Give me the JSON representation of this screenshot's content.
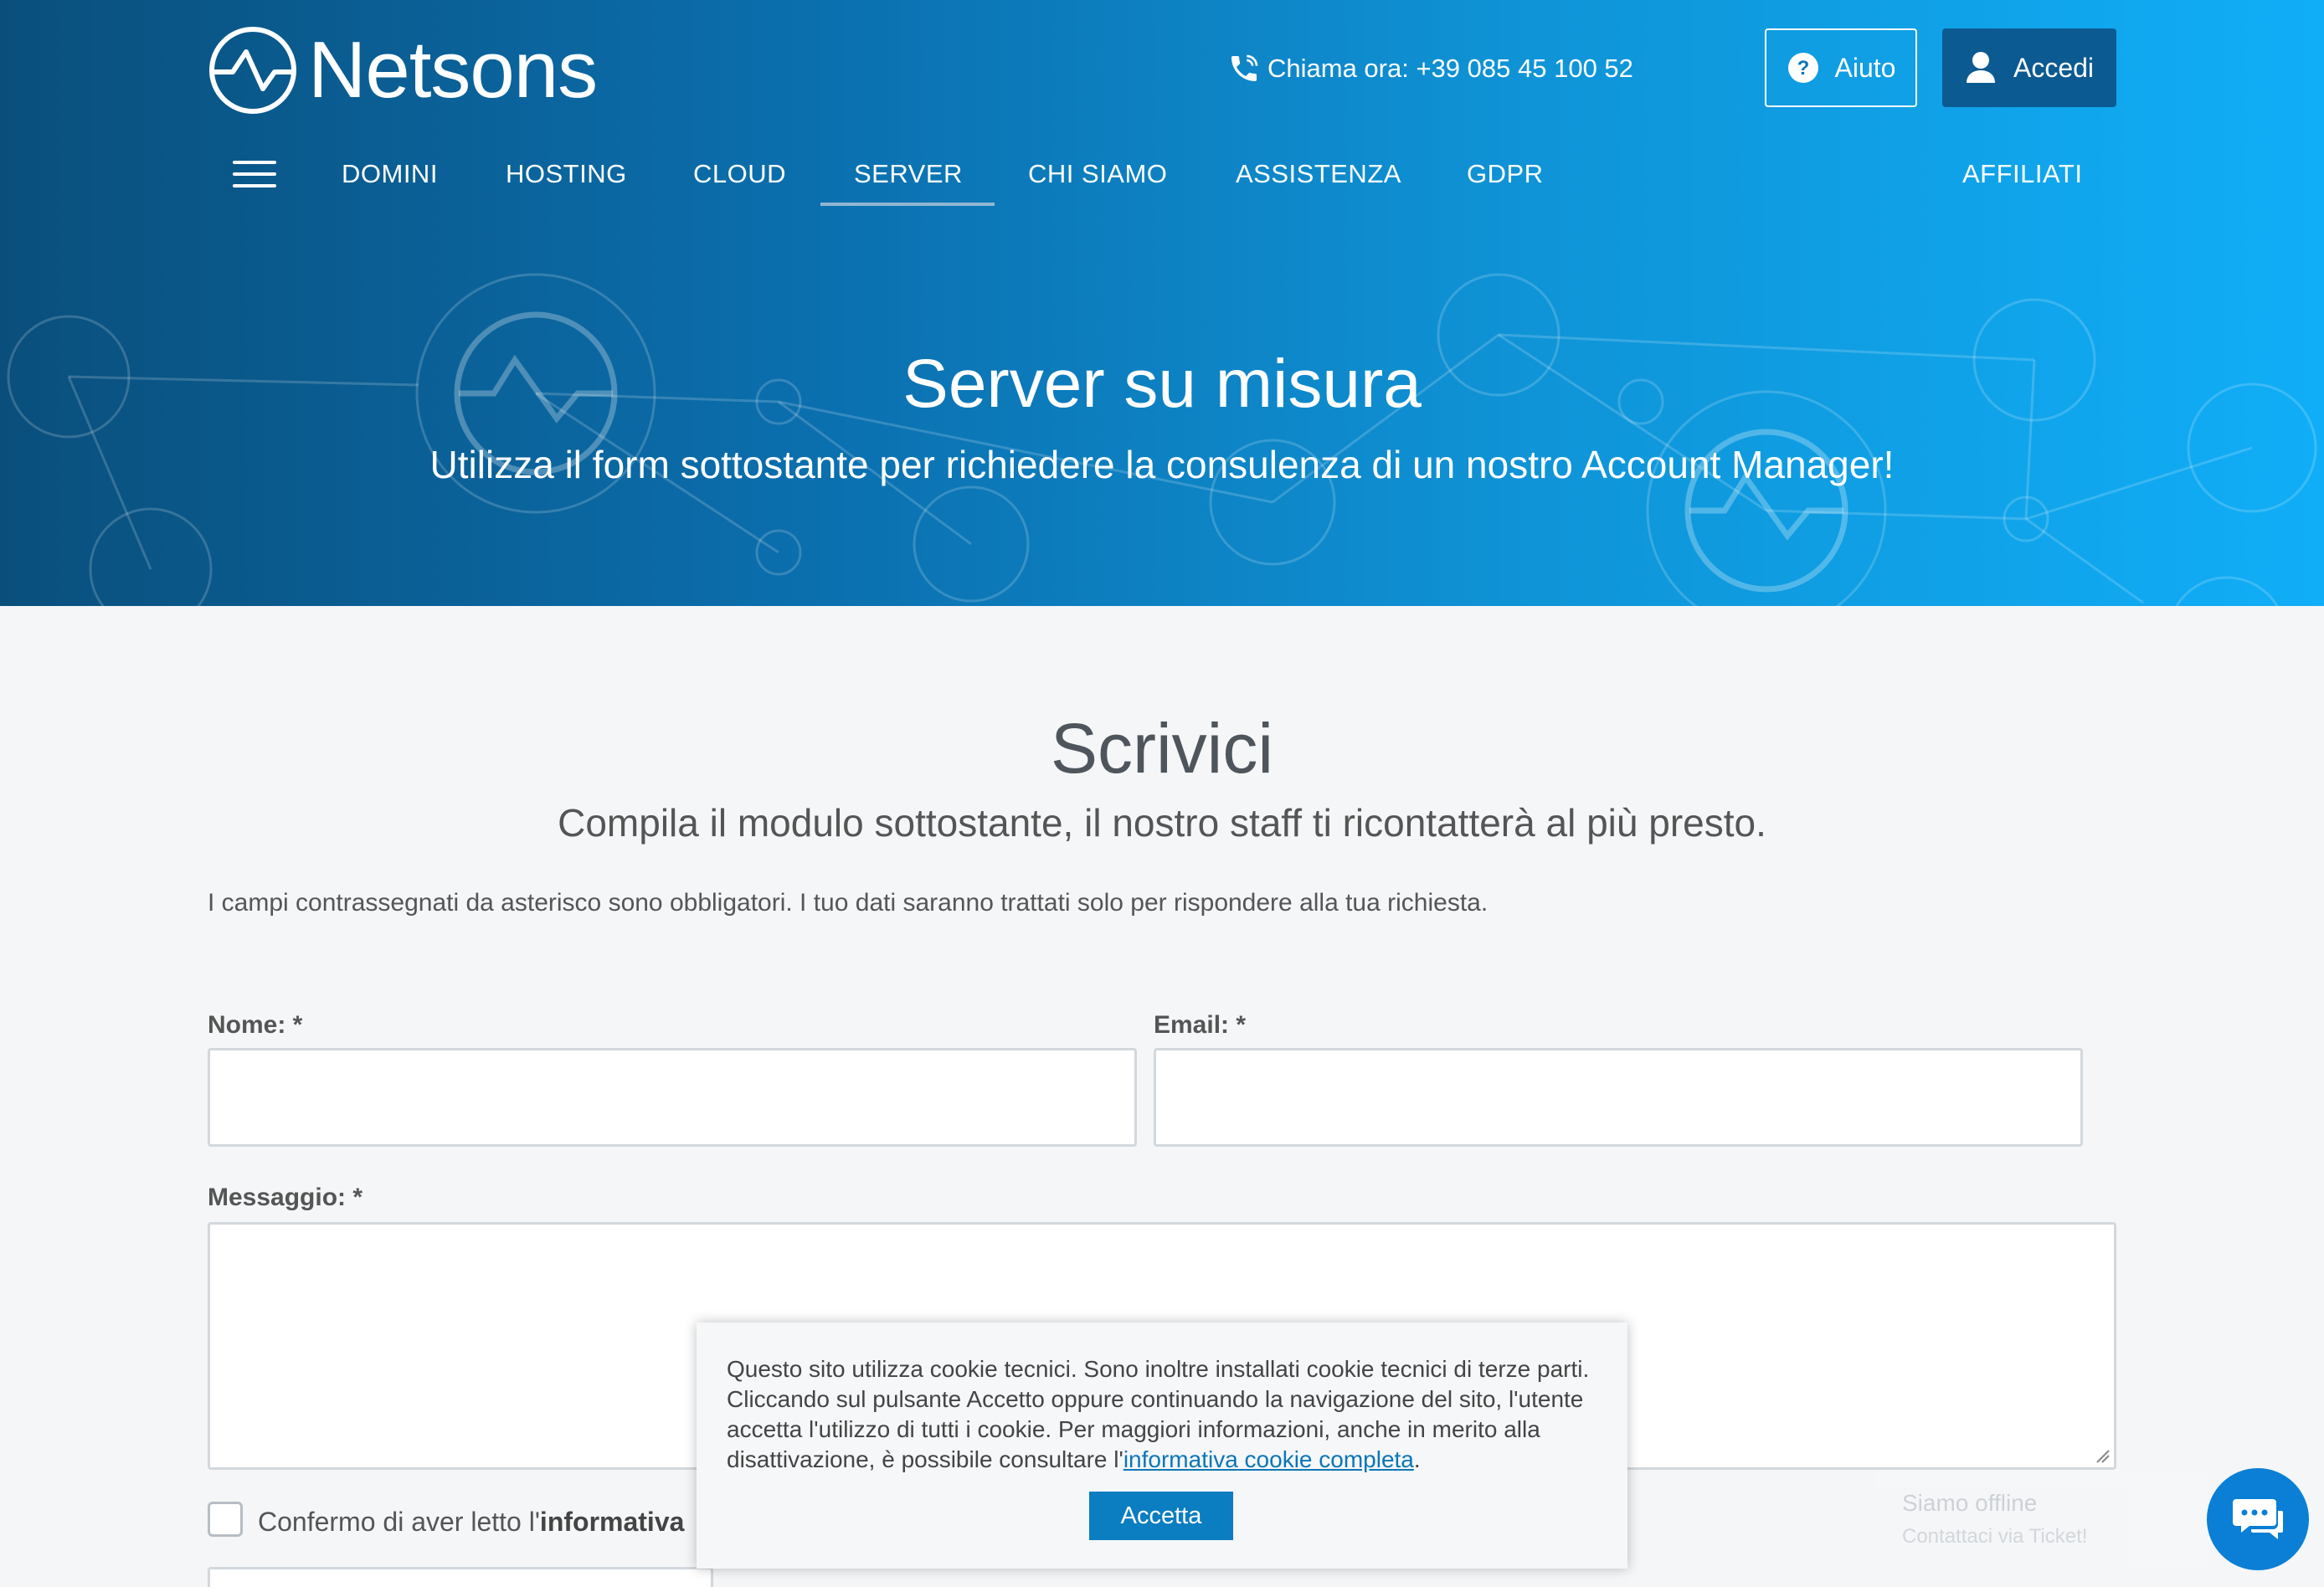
{
  "brand": {
    "name": "Netsons",
    "accent": "#0b7dc1",
    "hero_gradient": [
      "#0a4f7c",
      "#10aef7"
    ]
  },
  "header": {
    "phone_label": "Chiama ora: +39 085 45 100 52",
    "help_label": "Aiuto",
    "login_label": "Accedi"
  },
  "nav": {
    "items": [
      "DOMINI",
      "HOSTING",
      "CLOUD",
      "SERVER",
      "CHI SIAMO",
      "ASSISTENZA",
      "GDPR"
    ],
    "active": "SERVER",
    "affiliates": "AFFILIATI"
  },
  "hero": {
    "title": "Server su misura",
    "subtitle": "Utilizza il form sottostante per richiedere la consulenza di un nostro Account Manager!"
  },
  "contact": {
    "title": "Scrivici",
    "subtitle": "Compila il modulo sottostante, il nostro staff ti ricontatterà al più presto.",
    "note": "I campi contrassegnati da asterisco sono obbligatori. I tuo dati saranno trattati solo per rispondere alla tua richiesta.",
    "name_label": "Nome: *",
    "email_label": "Email: *",
    "message_label": "Messaggio: *",
    "consent_prefix": "Confermo di aver letto l'",
    "consent_bold": "informativa"
  },
  "cookie": {
    "text": "Questo sito utilizza cookie tecnici. Sono inoltre installati cookie tecnici di terze parti. Cliccando sul pulsante Accetto oppure continuando la navigazione del sito, l'utente accetta l'utilizzo di tutti i cookie. Per maggiori informazioni, anche in merito alla disattivazione, è possibile consultare l'",
    "link": "informativa cookie completa",
    "end": ".",
    "button": "Accetta"
  },
  "chat": {
    "status": "Siamo offline",
    "sub": "Contattaci via Ticket!"
  }
}
